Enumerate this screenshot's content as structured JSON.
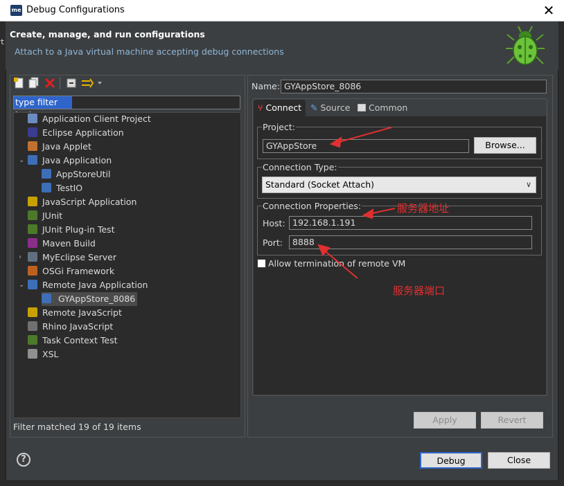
{
  "window": {
    "app_logo": "me",
    "title": "Debug Configurations",
    "close_glyph": "✕"
  },
  "banner": {
    "title": "Create, manage, and run configurations",
    "subtitle": "Attach to a Java virtual machine accepting debug connections",
    "icon": "bug-icon"
  },
  "toolbar": {
    "icons": [
      "new-configuration-icon",
      "duplicate-icon",
      "delete-icon",
      "collapse-all-icon",
      "filter-icon"
    ]
  },
  "filter": {
    "placeholder": "type filter text",
    "value": "type filter text"
  },
  "tree": {
    "items": [
      {
        "label": "Application Client Project",
        "icon": "app-client-icon",
        "level": 0
      },
      {
        "label": "Eclipse Application",
        "icon": "eclipse-icon",
        "level": 0
      },
      {
        "label": "Java Applet",
        "icon": "applet-icon",
        "level": 0
      },
      {
        "label": "Java Application",
        "icon": "java-app-icon",
        "level": 0,
        "expanded": true
      },
      {
        "label": "AppStoreUtil",
        "icon": "java-app-icon",
        "level": 1
      },
      {
        "label": "TestIO",
        "icon": "java-app-icon",
        "level": 1
      },
      {
        "label": "JavaScript Application",
        "icon": "javascript-icon",
        "level": 0
      },
      {
        "label": "JUnit",
        "icon": "junit-icon",
        "level": 0
      },
      {
        "label": "JUnit Plug-in Test",
        "icon": "junit-plugin-icon",
        "level": 0
      },
      {
        "label": "Maven Build",
        "icon": "maven-icon",
        "level": 0
      },
      {
        "label": "MyEclipse Server",
        "icon": "server-icon",
        "level": 0,
        "collapsed": true
      },
      {
        "label": "OSGi Framework",
        "icon": "osgi-icon",
        "level": 0
      },
      {
        "label": "Remote Java Application",
        "icon": "remote-java-icon",
        "level": 0,
        "expanded": true
      },
      {
        "label": "GYAppStore_8086",
        "icon": "remote-java-icon",
        "level": 1,
        "selected": true
      },
      {
        "label": "Remote JavaScript",
        "icon": "remote-js-icon",
        "level": 0
      },
      {
        "label": "Rhino JavaScript",
        "icon": "rhino-icon",
        "level": 0
      },
      {
        "label": "Task Context Test",
        "icon": "task-icon",
        "level": 0
      },
      {
        "label": "XSL",
        "icon": "xsl-icon",
        "level": 0
      }
    ],
    "status": "Filter matched 19 of 19 items"
  },
  "config": {
    "name_label": "Name:",
    "name_value": "GYAppStore_8086",
    "tabs": [
      {
        "label": "Connect",
        "icon": "connect-icon",
        "active": true
      },
      {
        "label": "Source",
        "icon": "source-icon",
        "active": false
      },
      {
        "label": "Common",
        "icon": "common-icon",
        "active": false
      }
    ],
    "project": {
      "legend": "Project:",
      "value": "GYAppStore",
      "browse_label": "Browse..."
    },
    "connection_type": {
      "legend": "Connection Type:",
      "selected": "Standard (Socket Attach)"
    },
    "connection_properties": {
      "legend": "Connection Properties:",
      "host_label": "Host:",
      "host_value": "192.168.1.191",
      "port_label": "Port:",
      "port_value": "8888"
    },
    "allow_termination": {
      "label": "Allow termination of remote VM",
      "checked": false
    },
    "apply_label": "Apply",
    "revert_label": "Revert"
  },
  "annotations": {
    "host_note": "服务器地址",
    "port_note": "服务器端口",
    "color": "#e03030"
  },
  "footer": {
    "debug_label": "Debug",
    "close_label": "Close",
    "help_glyph": "?"
  }
}
